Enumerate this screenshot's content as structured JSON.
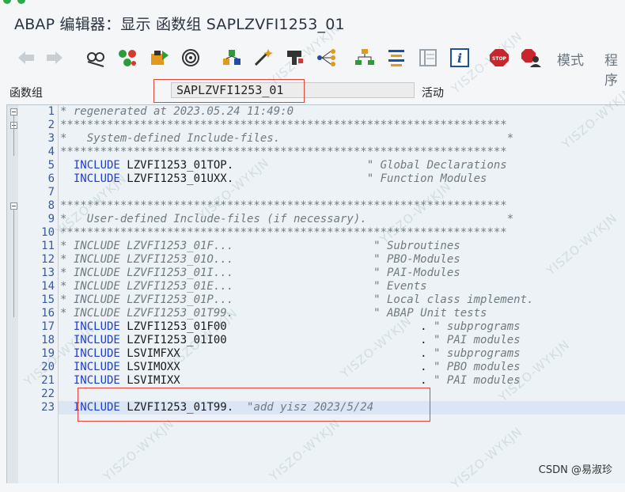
{
  "window": {
    "title": "ABAP 编辑器：显示 函数组 SAPLZVFI1253_01"
  },
  "toolbar": {
    "items": [
      {
        "name": "back-arrow-icon"
      },
      {
        "name": "forward-arrow-icon"
      },
      {
        "name": "display-change-icon"
      },
      {
        "name": "active-inactive-icon"
      },
      {
        "name": "check-object-icon"
      },
      {
        "name": "activate-icon"
      },
      {
        "name": "where-used-icon"
      },
      {
        "name": "wand-icon"
      },
      {
        "name": "stamp-icon"
      },
      {
        "name": "hierarchy-icon"
      },
      {
        "name": "object-list-icon"
      },
      {
        "name": "pattern-icon"
      },
      {
        "name": "info-icon"
      },
      {
        "name": "stop-icon"
      },
      {
        "name": "stop-user-icon"
      }
    ],
    "mode_label": "模式",
    "program_label": "程序"
  },
  "field": {
    "label": "函数组",
    "value": "SAPLZVFI1253_01",
    "status": "活动"
  },
  "editor": {
    "lines": [
      {
        "no": "1",
        "fold": true,
        "segments": [
          {
            "t": "* regenerated at 2023.05.24 11:49:0",
            "c": "cm"
          }
        ]
      },
      {
        "no": "2",
        "fold": true,
        "segments": [
          {
            "t": "*******************************************************************",
            "c": "cm"
          }
        ]
      },
      {
        "no": "3",
        "segments": [
          {
            "t": "*   System-defined Include-files.                                  *",
            "c": "cm"
          }
        ]
      },
      {
        "no": "4",
        "segments": [
          {
            "t": "*******************************************************************",
            "c": "cm"
          }
        ]
      },
      {
        "no": "5",
        "segments": [
          {
            "t": "  INCLUDE ",
            "c": "kw"
          },
          {
            "t": "LZVFI1253_01TOP.                    ",
            "c": "id"
          },
          {
            "t": "\" Global Declarations",
            "c": "cm"
          }
        ]
      },
      {
        "no": "6",
        "segments": [
          {
            "t": "  INCLUDE ",
            "c": "kw"
          },
          {
            "t": "LZVFI1253_01UXX.                    ",
            "c": "id"
          },
          {
            "t": "\" Function Modules",
            "c": "cm"
          }
        ]
      },
      {
        "no": "7",
        "segments": [
          {
            "t": "",
            "c": "id"
          }
        ]
      },
      {
        "no": "8",
        "fold": true,
        "segments": [
          {
            "t": "*******************************************************************",
            "c": "cm"
          }
        ]
      },
      {
        "no": "9",
        "segments": [
          {
            "t": "*   User-defined Include-files (if necessary).                     *",
            "c": "cm"
          }
        ]
      },
      {
        "no": "10",
        "segments": [
          {
            "t": "*******************************************************************",
            "c": "cm"
          }
        ]
      },
      {
        "no": "11",
        "segments": [
          {
            "t": "* INCLUDE LZVFI1253_01F...                     \" Subroutines",
            "c": "cm"
          }
        ]
      },
      {
        "no": "12",
        "segments": [
          {
            "t": "* INCLUDE LZVFI1253_01O...                     \" PBO-Modules",
            "c": "cm"
          }
        ]
      },
      {
        "no": "13",
        "segments": [
          {
            "t": "* INCLUDE LZVFI1253_01I...                     \" PAI-Modules",
            "c": "cm"
          }
        ]
      },
      {
        "no": "14",
        "segments": [
          {
            "t": "* INCLUDE LZVFI1253_01E...                     \" Events",
            "c": "cm"
          }
        ]
      },
      {
        "no": "15",
        "segments": [
          {
            "t": "* INCLUDE LZVFI1253_01P...                     \" Local class implement.",
            "c": "cm"
          }
        ]
      },
      {
        "no": "16",
        "segments": [
          {
            "t": "* INCLUDE LZVFI1253_01T99.                     \" ABAP Unit tests",
            "c": "cm"
          }
        ]
      },
      {
        "no": "17",
        "segments": [
          {
            "t": "  INCLUDE ",
            "c": "kw"
          },
          {
            "t": "LZVFI1253_01F00                             . ",
            "c": "id"
          },
          {
            "t": "\" subprograms",
            "c": "cm"
          }
        ]
      },
      {
        "no": "18",
        "segments": [
          {
            "t": "  INCLUDE ",
            "c": "kw"
          },
          {
            "t": "LZVFI1253_01I00                             . ",
            "c": "id"
          },
          {
            "t": "\" PAI modules",
            "c": "cm"
          }
        ]
      },
      {
        "no": "19",
        "segments": [
          {
            "t": "  INCLUDE ",
            "c": "kw"
          },
          {
            "t": "LSVIMFXX                                    . ",
            "c": "id"
          },
          {
            "t": "\" subprograms",
            "c": "cm"
          }
        ]
      },
      {
        "no": "20",
        "segments": [
          {
            "t": "  INCLUDE ",
            "c": "kw"
          },
          {
            "t": "LSVIMOXX                                    . ",
            "c": "id"
          },
          {
            "t": "\" PBO modules",
            "c": "cm"
          }
        ]
      },
      {
        "no": "21",
        "segments": [
          {
            "t": "  INCLUDE ",
            "c": "kw"
          },
          {
            "t": "LSVIMIXX                                    . ",
            "c": "id"
          },
          {
            "t": "\" PAI modules",
            "c": "cm"
          }
        ]
      },
      {
        "no": "22",
        "segments": [
          {
            "t": "",
            "c": "id"
          }
        ]
      },
      {
        "no": "23",
        "segments": [
          {
            "t": "  INCLUDE ",
            "c": "kw"
          },
          {
            "t": "LZVFI1253_01T99.  ",
            "c": "id"
          },
          {
            "t": "\"add yisz 2023/5/24",
            "c": "cm"
          }
        ]
      }
    ]
  },
  "watermark_text": "YISZO-WYKJN",
  "credit": "CSDN @易淑珍",
  "colors": {
    "keyword": "#1f3fcf",
    "comment": "#707a82",
    "line_number": "#3b5a9a",
    "highlight_box": "#e2453a",
    "current_line": "#dbe6f4"
  }
}
